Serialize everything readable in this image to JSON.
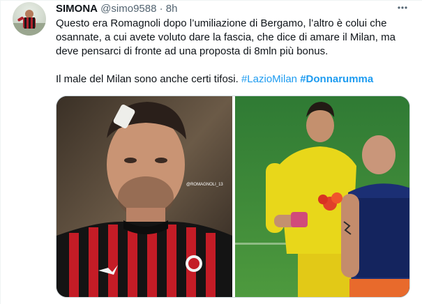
{
  "tweet": {
    "display_name": "SIMONA",
    "handle": "@simo9588",
    "separator": "·",
    "time": "8h",
    "more_icon": "ellipsis-icon",
    "paragraph_1": "Questo era Romagnoli dopo l’umiliazione di Bergamo, l’altro è colui che osannate, a cui avete voluto dare la fascia, che dice di amare il Milan, ma deve pensarci di fronte ad una proposta di 8mln più bonus.",
    "paragraph_2_text": "Il male del Milan sono anche certi tifosi.",
    "hashtag_1": "#LazioMilan",
    "hashtag_2": "#Donnarumma",
    "image_watermark": "@ROMAGNOLI_13",
    "link_color": "#1d9bf0"
  }
}
